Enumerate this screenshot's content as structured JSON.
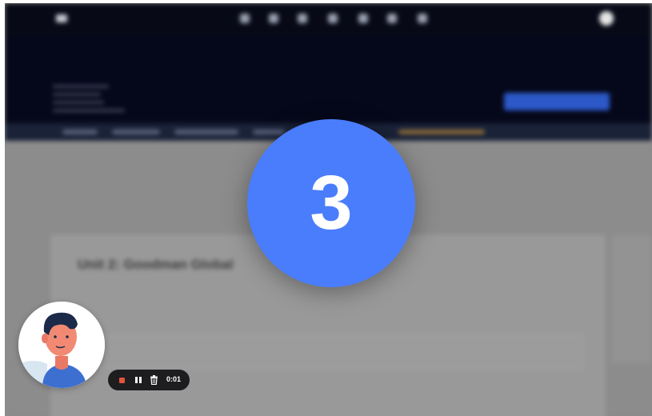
{
  "background_app": {
    "breadcrumb": "",
    "page_title": "",
    "primary_button": "",
    "content": {
      "card_title": "Unit 2: Goodman Global",
      "card_subtitle": "",
      "field_label": "",
      "field_value": ""
    }
  },
  "countdown": {
    "value": "3",
    "color": "#4a7dfc"
  },
  "webcam": {
    "icon": "avatar-illustration"
  },
  "recorder": {
    "stop_icon": "stop-icon",
    "pause_icon": "pause-icon",
    "trash_icon": "trash-icon",
    "elapsed": "0:01",
    "stop_color": "#e0533c"
  }
}
